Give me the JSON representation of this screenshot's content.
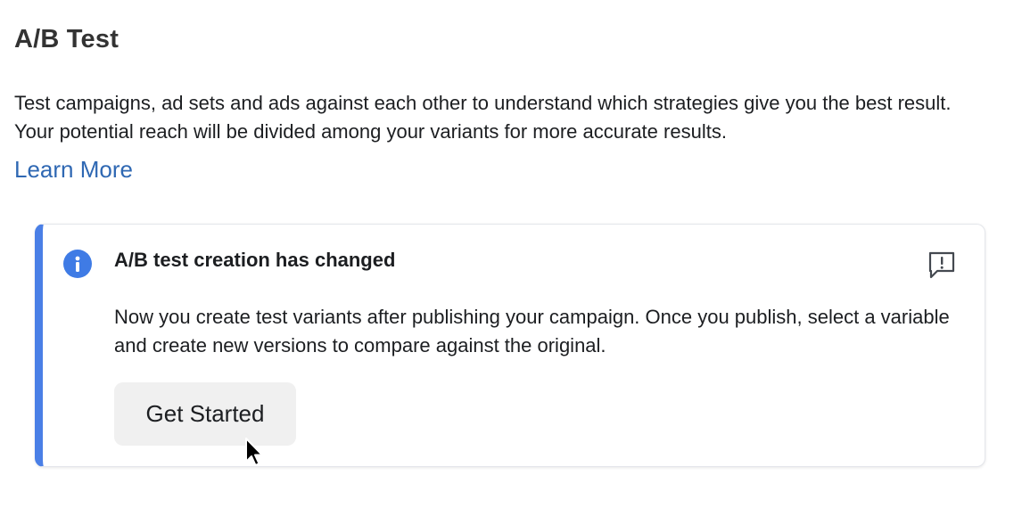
{
  "section": {
    "title": "A/B Test",
    "description": "Test campaigns, ad sets and ads against each other to understand which strategies give you the best result. Your potential reach will be divided among your variants for more accurate results.",
    "learn_more": "Learn More"
  },
  "notice": {
    "icon": "info-icon",
    "title": "A/B test creation has changed",
    "body": "Now you create test variants after publishing your campaign. Once you publish, select a variable and create new versions to compare against the original.",
    "button_label": "Get Started",
    "feedback_icon": "report-feedback-icon",
    "accent_color": "#4a7fe6"
  },
  "colors": {
    "link": "#2f68b3",
    "info_icon": "#3f7be5",
    "button_bg": "#f0f0f0"
  }
}
